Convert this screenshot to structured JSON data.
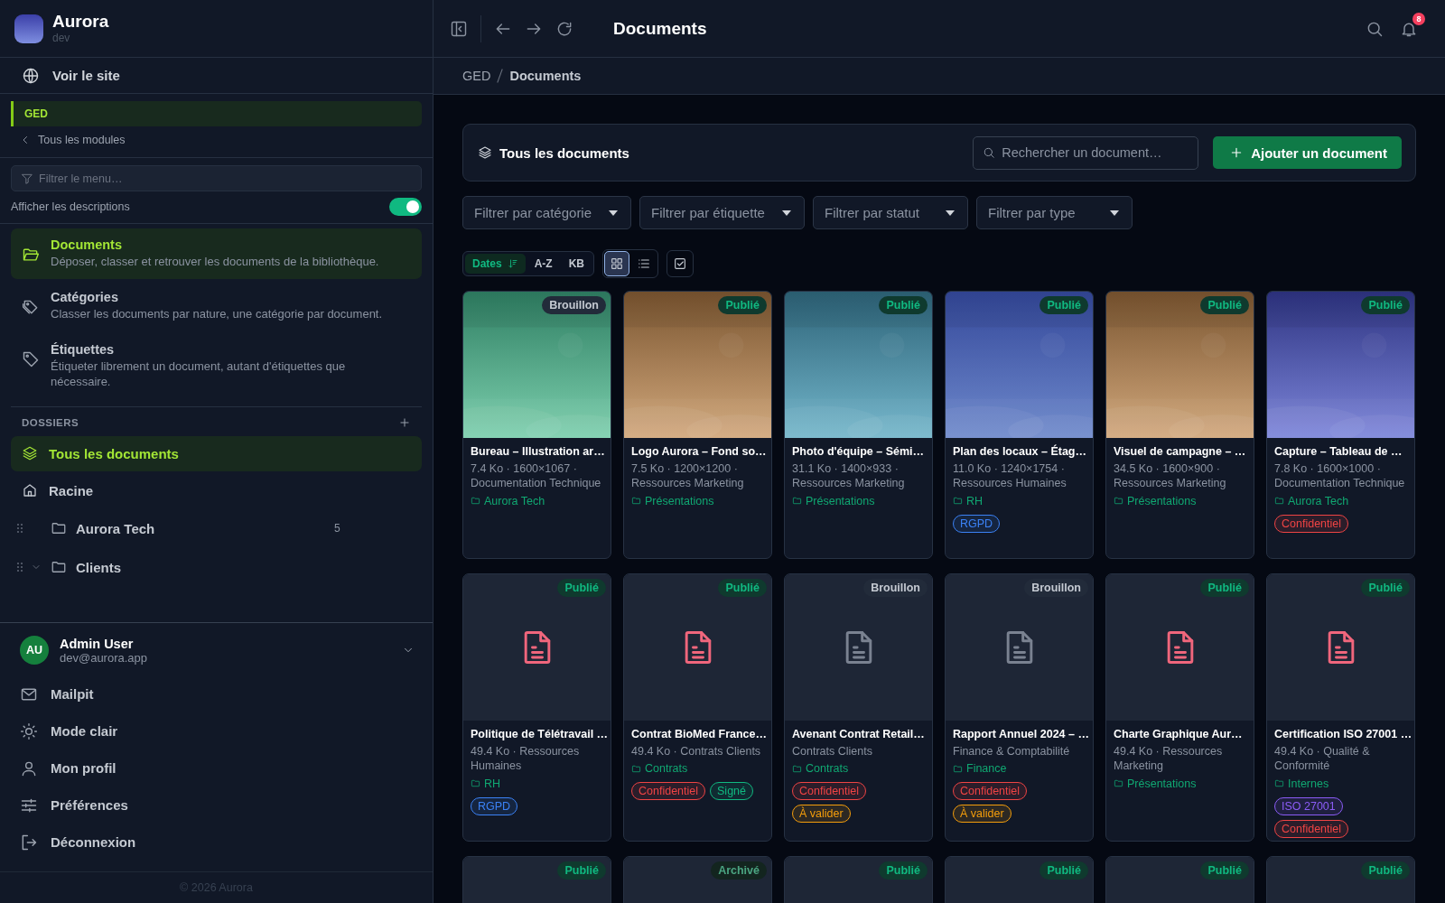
{
  "brand": {
    "name": "Aurora",
    "env": "dev"
  },
  "site_link": "Voir le site",
  "module": {
    "name": "GED",
    "back": "Tous les modules"
  },
  "menu_filter": {
    "placeholder": "Filtrer le menu…"
  },
  "descriptions_toggle": {
    "label": "Afficher les descriptions",
    "on": true
  },
  "nav": [
    {
      "kind": "folder",
      "title": "Documents",
      "description": "Déposer, classer et retrouver les documents de la bibliothèque.",
      "selected": true
    },
    {
      "kind": "tags",
      "title": "Catégories",
      "description": "Classer les documents par nature, une catégorie par document.",
      "selected": false
    },
    {
      "kind": "tag",
      "title": "Étiquettes",
      "description": "Étiqueter librement un document, autant d'étiquettes que nécessaire.",
      "selected": false
    }
  ],
  "folders": {
    "title": "DOSSIERS",
    "items": [
      {
        "kind": "all",
        "label": "Tous les documents",
        "selected": true
      },
      {
        "kind": "home",
        "label": "Racine",
        "selected": false,
        "children": [
          {
            "label": "Aurora Tech",
            "count": "5",
            "selected": false
          },
          {
            "label": "Clients",
            "selected": false,
            "expanded": true
          }
        ]
      }
    ]
  },
  "user": {
    "initials": "AU",
    "name": "Admin User",
    "email": "dev@aurora.app"
  },
  "account_menu": [
    {
      "kind": "mail",
      "label": "Mailpit"
    },
    {
      "kind": "sun",
      "label": "Mode clair"
    },
    {
      "kind": "user",
      "label": "Mon profil"
    },
    {
      "kind": "sliders",
      "label": "Préférences"
    },
    {
      "kind": "logout",
      "label": "Déconnexion"
    }
  ],
  "footer": "© 2026 Aurora",
  "topbar": {
    "title": "Documents",
    "notifications": "8"
  },
  "breadcrumb": [
    "GED",
    "Documents"
  ],
  "panel": {
    "title": "Tous les documents",
    "search_placeholder": "Rechercher un document…",
    "add_button": "Ajouter un document"
  },
  "filters": [
    "Filtrer par catégorie",
    "Filtrer par étiquette",
    "Filtrer par statut",
    "Filtrer par type"
  ],
  "sort": [
    {
      "label": "Dates",
      "selected": true
    },
    {
      "label": "A-Z",
      "selected": false
    },
    {
      "label": "KB",
      "selected": false
    }
  ],
  "views": [
    {
      "kind": "grid",
      "selected": true
    },
    {
      "kind": "list",
      "selected": false
    }
  ],
  "documents": [
    {
      "kind": "picture",
      "status": {
        "label": "Brouillon",
        "kind": "draft"
      },
      "title": "Bureau – Illustration ar…",
      "meta": "7.4 Ko · 1600×1067 · Documentation Technique",
      "folder": "Aurora Tech"
    },
    {
      "kind": "picture",
      "status": {
        "label": "Publié",
        "kind": "published"
      },
      "title": "Logo Aurora – Fond so…",
      "meta": "7.5 Ko · 1200×1200 · Ressources Marketing",
      "folder": "Présentations"
    },
    {
      "kind": "picture",
      "status": {
        "label": "Publié",
        "kind": "published"
      },
      "title": "Photo d'équipe – Sémi…",
      "meta": "31.1 Ko · 1400×933 · Ressources Marketing",
      "folder": "Présentations"
    },
    {
      "kind": "picture",
      "status": {
        "label": "Publié",
        "kind": "published"
      },
      "title": "Plan des locaux – Étag…",
      "meta": "11.0 Ko · 1240×1754 · Ressources Humaines",
      "folder": "RH",
      "tags": [
        {
          "label": "RGPD",
          "color": "#3b82f6"
        }
      ]
    },
    {
      "kind": "picture",
      "status": {
        "label": "Publié",
        "kind": "published"
      },
      "title": "Visuel de campagne – …",
      "meta": "34.5 Ko · 1600×900 · Ressources Marketing",
      "folder": "Présentations"
    },
    {
      "kind": "picture",
      "status": {
        "label": "Publié",
        "kind": "published"
      },
      "title": "Capture – Tableau de …",
      "meta": "7.8 Ko · 1600×1000 · Documentation Technique",
      "folder": "Aurora Tech",
      "tags": [
        {
          "label": "Confidentiel",
          "color": "#ef4444"
        }
      ]
    },
    {
      "kind": "file",
      "status": {
        "label": "Publié",
        "kind": "published"
      },
      "title": "Politique de Télétravail …",
      "meta": "49.4 Ko · Ressources Humaines",
      "folder": "RH",
      "tags": [
        {
          "label": "RGPD",
          "color": "#3b82f6"
        }
      ]
    },
    {
      "kind": "file",
      "status": {
        "label": "Publié",
        "kind": "published"
      },
      "title": "Contrat BioMed France…",
      "meta": "49.4 Ko · Contrats Clients",
      "folder": "Contrats",
      "tags": [
        {
          "label": "Confidentiel",
          "color": "#ef4444"
        },
        {
          "label": "Signé",
          "color": "#10b981"
        }
      ]
    },
    {
      "kind": "file",
      "status": {
        "label": "Brouillon",
        "kind": "draft"
      },
      "title": "Avenant Contrat Retail…",
      "meta": "Contrats Clients",
      "folder": "Contrats",
      "tags": [
        {
          "label": "Confidentiel",
          "color": "#ef4444"
        },
        {
          "label": "À valider",
          "color": "#f59e0b"
        }
      ]
    },
    {
      "kind": "file",
      "status": {
        "label": "Brouillon",
        "kind": "draft"
      },
      "title": "Rapport Annuel 2024 – …",
      "meta": "Finance & Comptabilité",
      "folder": "Finance",
      "tags": [
        {
          "label": "Confidentiel",
          "color": "#ef4444"
        },
        {
          "label": "À valider",
          "color": "#f59e0b"
        }
      ]
    },
    {
      "kind": "file",
      "status": {
        "label": "Publié",
        "kind": "published"
      },
      "title": "Charte Graphique Aur…",
      "meta": "49.4 Ko · Ressources Marketing",
      "folder": "Présentations"
    },
    {
      "kind": "file",
      "status": {
        "label": "Publié",
        "kind": "published"
      },
      "title": "Certification ISO 27001 …",
      "meta": "49.4 Ko · Qualité & Conformité",
      "folder": "Internes",
      "tags": [
        {
          "label": "ISO 27001",
          "color": "#8b5cf6"
        },
        {
          "label": "Confidentiel",
          "color": "#ef4444"
        }
      ]
    },
    {
      "status": {
        "label": "Publié",
        "kind": "published"
      }
    },
    {
      "status": {
        "label": "Archivé",
        "kind": "archived"
      }
    },
    {
      "status": {
        "label": "Publié",
        "kind": "published"
      }
    },
    {
      "status": {
        "label": "Publié",
        "kind": "published"
      }
    },
    {
      "status": {
        "label": "Publié",
        "kind": "published"
      }
    },
    {
      "status": {
        "label": "Publié",
        "kind": "published"
      }
    }
  ]
}
